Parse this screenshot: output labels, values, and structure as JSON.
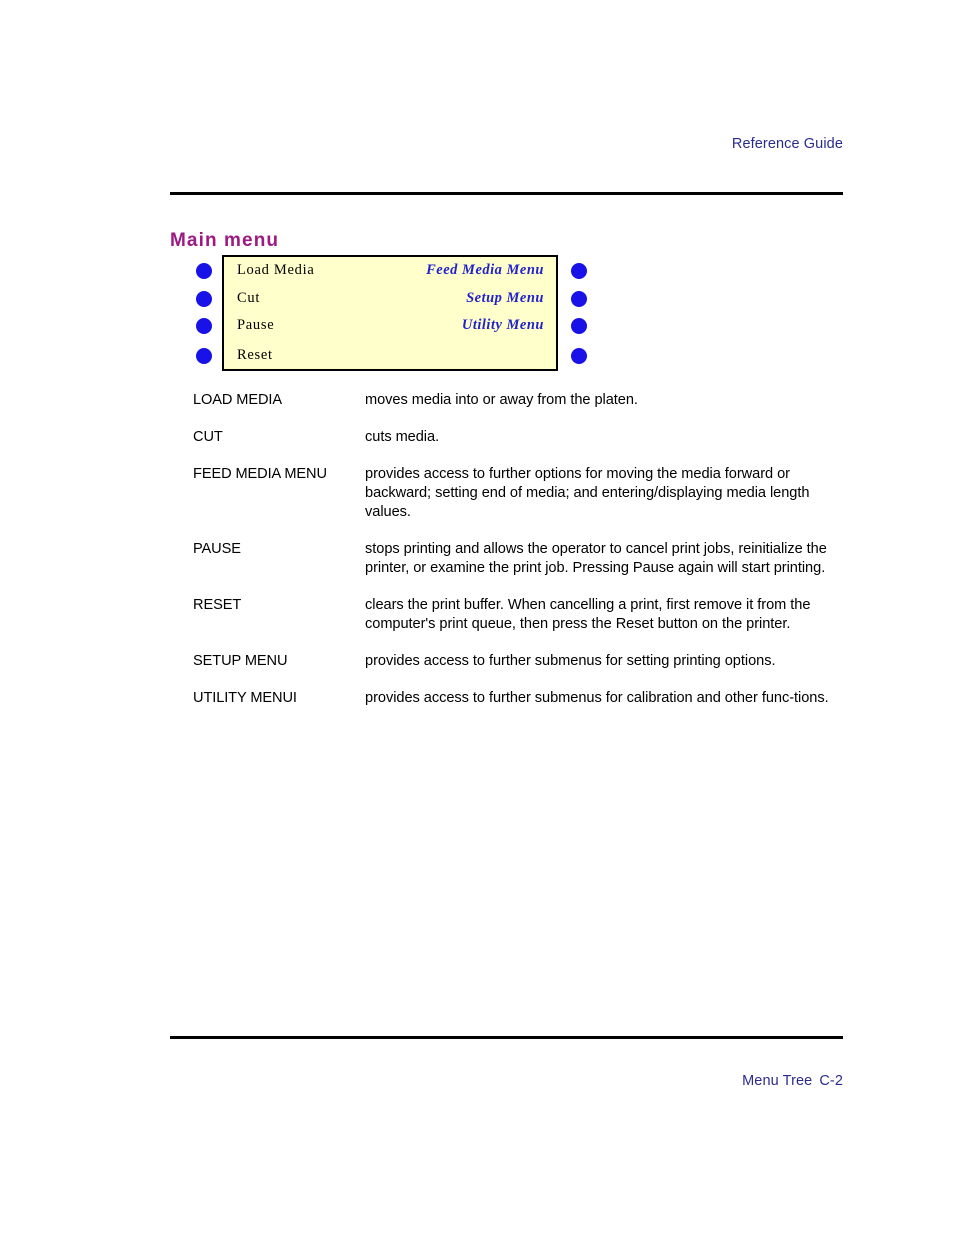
{
  "header": {
    "running_head": "Reference Guide"
  },
  "section": {
    "title": "Main menu"
  },
  "lcd_panel": {
    "background_color": "#ffffcc",
    "border_color": "#000000",
    "led_color": "#1811e8",
    "left_text_color": "#000000",
    "right_text_color": "#2222cc",
    "rows": [
      {
        "left": "Load Media",
        "right": "Feed Media Menu"
      },
      {
        "left": "Cut",
        "right": "Setup Menu"
      },
      {
        "left": "Pause",
        "right": "Utility Menu"
      },
      {
        "left": "Reset",
        "right": ""
      }
    ]
  },
  "definitions": [
    {
      "term": "LOAD MEDIA",
      "description": "moves media into or away from the platen."
    },
    {
      "term": "CUT",
      "description": "cuts media."
    },
    {
      "term": "FEED MEDIA MENU",
      "description": "provides access to further options for moving the media forward or backward; setting end of media; and entering/displaying media length values."
    },
    {
      "term": "PAUSE",
      "description": "stops printing and allows the operator to cancel print jobs, reinitialize the printer, or examine the print job.  Pressing Pause again will start printing."
    },
    {
      "term": "RESET",
      "description": "clears the print buffer. When cancelling a print, first remove it from the computer's print queue, then press the Reset button on the printer."
    },
    {
      "term": "SETUP MENU",
      "description": "provides access to further submenus for setting printing options."
    },
    {
      "term": "UTILITY MENUI",
      "description": "provides access to further submenus for calibration and other func-tions."
    }
  ],
  "footer": {
    "chapter_label": "Menu Tree",
    "page_number": "C-2"
  },
  "colors": {
    "header_footer_text": "#2b2b8f",
    "section_title": "#9c1a82",
    "rule": "#000000"
  }
}
